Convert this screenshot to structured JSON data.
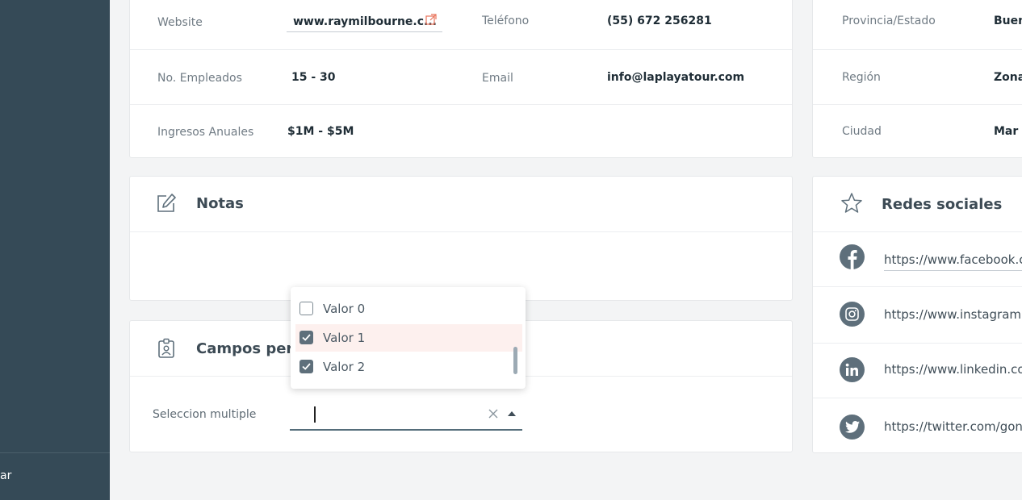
{
  "sidebar": {
    "footer_label": "ar"
  },
  "company": {
    "website_label": "Website",
    "website_value": "www.raymilbourne.c...",
    "phone_label": "Teléfono",
    "phone_value": "(55) 672 256281",
    "employees_label": "No. Empleados",
    "employees_value": "15 - 30",
    "email_label": "Email",
    "email_value": "info@laplayatour.com",
    "revenue_label": "Ingresos Anuales",
    "revenue_value": "$1M - $5M"
  },
  "location": {
    "province_label": "Provincia/Estado",
    "province_value": "Buen",
    "region_label": "Región",
    "region_value": "Zona",
    "city_label": "Ciudad",
    "city_value": "Mar c"
  },
  "notes": {
    "title": "Notas"
  },
  "custom_fields": {
    "title": "Campos perso",
    "multi_select_label": "Seleccion multiple",
    "options": [
      {
        "label": "Valor 0",
        "checked": false
      },
      {
        "label": "Valor 1",
        "checked": true
      },
      {
        "label": "Valor 2",
        "checked": true
      }
    ]
  },
  "social": {
    "title": "Redes sociales",
    "links": [
      {
        "network": "facebook",
        "url": "https://www.facebook.co"
      },
      {
        "network": "instagram",
        "url": "https://www.instagram.c"
      },
      {
        "network": "linkedin",
        "url": "https://www.linkedin.cor"
      },
      {
        "network": "twitter",
        "url": "https://twitter.com/gonza"
      }
    ]
  },
  "colors": {
    "sidebar": "#354a57",
    "accent_link_icon": "#e8735a",
    "icon_gray": "#5e6f7b",
    "selected_option_bg": "#fdf0ee"
  }
}
